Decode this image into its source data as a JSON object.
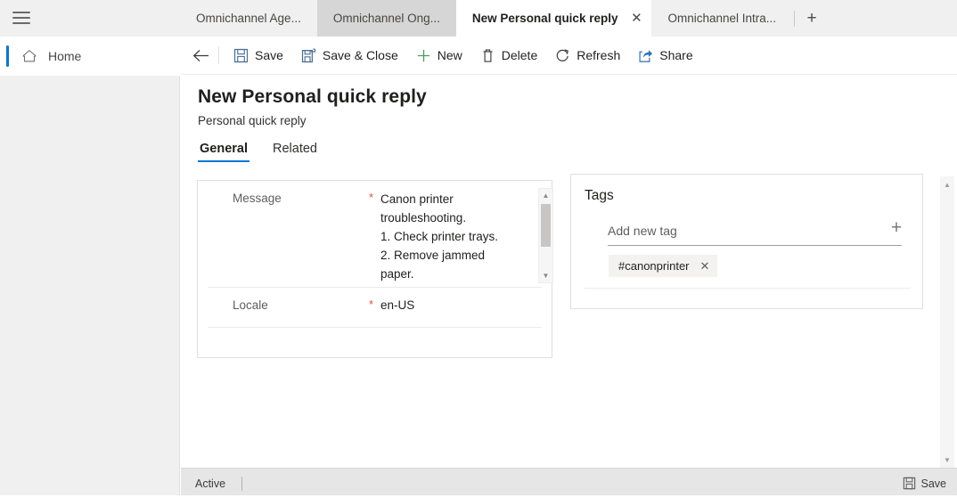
{
  "window": {
    "menu_icon": "hamburger-icon"
  },
  "tabs": [
    {
      "label": "Omnichannel Age...",
      "state": "inactive"
    },
    {
      "label": "Omnichannel Ong...",
      "state": "hovered"
    },
    {
      "label": "New Personal quick reply",
      "state": "active",
      "close_icon": "close-icon"
    },
    {
      "label": "Omnichannel Intra...",
      "state": "inactive"
    }
  ],
  "tab_add_label": "+",
  "sidebar": {
    "home": {
      "label": "Home",
      "icon": "home-icon"
    }
  },
  "commandbar": {
    "back_icon": "back-arrow-icon",
    "buttons": [
      {
        "label": "Save",
        "icon": "save-icon"
      },
      {
        "label": "Save & Close",
        "icon": "save-and-close-icon"
      },
      {
        "label": "New",
        "icon": "plus-icon"
      },
      {
        "label": "Delete",
        "icon": "trash-icon"
      },
      {
        "label": "Refresh",
        "icon": "refresh-icon"
      },
      {
        "label": "Share",
        "icon": "share-icon"
      }
    ]
  },
  "page": {
    "title": "New Personal quick reply",
    "subtitle": "Personal quick reply",
    "form_tabs": [
      {
        "label": "General",
        "selected": true
      },
      {
        "label": "Related",
        "selected": false
      }
    ]
  },
  "form": {
    "message": {
      "label": "Message",
      "required_marker": "*",
      "lines": [
        "Canon printer",
        "troubleshooting.",
        "1. Check printer trays.",
        "2. Remove jammed",
        "paper."
      ],
      "scroll_up_icon": "▲",
      "scroll_down_icon": "▼"
    },
    "locale": {
      "label": "Locale",
      "required_marker": "*",
      "value": "en-US"
    }
  },
  "tags_panel": {
    "title": "Tags",
    "input_placeholder": "Add new tag",
    "add_icon": "plus-icon",
    "tags": [
      {
        "label": "#canonprinter",
        "remove_icon": "close-icon"
      }
    ]
  },
  "content_scrollbar": {
    "up_icon": "▲",
    "down_icon": "▼"
  },
  "statusbar": {
    "state": "Active",
    "save": {
      "label": "Save",
      "icon": "save-icon"
    }
  },
  "colors": {
    "accent": "#0078d4",
    "required": "#e74c3c",
    "chrome": "#f0f0f0",
    "statusbar": "#e6e6e6"
  }
}
